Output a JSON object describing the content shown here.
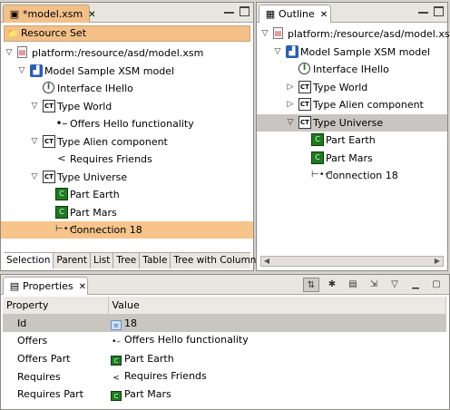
{
  "editor": {
    "tab_title": "*model.xsm",
    "header": "Resource Set",
    "tree": [
      {
        "label": "platform:/resource/asd/model.xsm",
        "icon": "file-icon"
      },
      {
        "label": "Model Sample XSM model",
        "icon": "model-icon"
      },
      {
        "label": "Interface IHello",
        "icon": "interface-icon"
      },
      {
        "label": "Type World",
        "icon": "component-type-icon"
      },
      {
        "label": "Offers Hello functionality",
        "icon": "offer-icon"
      },
      {
        "label": "Type Alien component",
        "icon": "component-type-icon"
      },
      {
        "label": "Requires Friends",
        "icon": "require-icon"
      },
      {
        "label": "Type Universe",
        "icon": "component-type-icon"
      },
      {
        "label": "Part Earth",
        "icon": "part-icon"
      },
      {
        "label": "Part Mars",
        "icon": "part-icon"
      },
      {
        "label": "Connection 18",
        "icon": "connection-icon"
      }
    ],
    "bottom_tabs": [
      "Selection",
      "Parent",
      "List",
      "Tree",
      "Table",
      "Tree with Columns"
    ]
  },
  "outline": {
    "tab_title": "Outline",
    "tree": [
      {
        "label": "platform:/resource/asd/model.xsm"
      },
      {
        "label": "Model Sample XSM model"
      },
      {
        "label": "Interface IHello"
      },
      {
        "label": "Type World"
      },
      {
        "label": "Type Alien component"
      },
      {
        "label": "Type Universe"
      },
      {
        "label": "Part Earth"
      },
      {
        "label": "Part Mars"
      },
      {
        "label": "Connection 18"
      }
    ]
  },
  "properties": {
    "tab_title": "Properties",
    "col_property": "Property",
    "col_value": "Value",
    "rows": [
      {
        "property": "Id",
        "value": "18",
        "icon": "id-icon"
      },
      {
        "property": "Offers",
        "value": "Offers Hello functionality",
        "icon": "offer-icon"
      },
      {
        "property": "Offers Part",
        "value": "Part Earth",
        "icon": "part-icon"
      },
      {
        "property": "Requires",
        "value": "Requires Friends",
        "icon": "require-icon"
      },
      {
        "property": "Requires Part",
        "value": "Part Mars",
        "icon": "part-icon"
      }
    ]
  },
  "colors": {
    "selection_orange": "#f7c48c",
    "selection_gray": "#c9c6c1",
    "chrome": "#d6d3ce"
  }
}
